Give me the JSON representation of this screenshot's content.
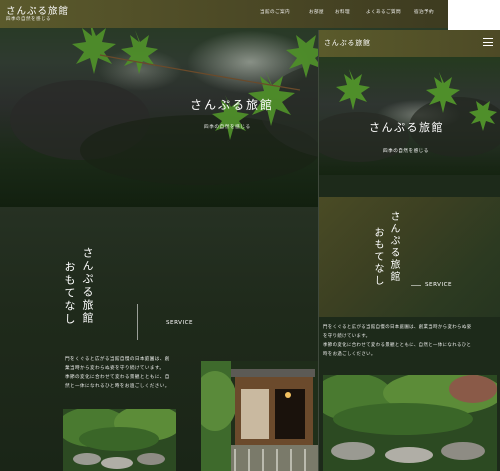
{
  "desktop": {
    "logo": "さんぷる旅館",
    "logo_sub": "四季の自然を感じる",
    "nav": [
      "当館のご案内",
      "お部屋",
      "お料理",
      "よくあるご質問",
      "宿泊予約"
    ],
    "hero_title": "さんぷる旅館",
    "hero_sub": "四季の自然を感じる",
    "heading_col1": "さんぷる旅館",
    "heading_col2": "おもてなし",
    "service_label": "SERVICE",
    "paragraph_1": "門をくぐると広がる当館自慢の日本庭園は、創",
    "paragraph_2": "業当時から変わらぬ姿を守り続けています。",
    "paragraph_3": "季節の変化に合わせて変わる景観とともに、自",
    "paragraph_4": "然と一体になれるひと時をお過ごしください。"
  },
  "mobile": {
    "logo": "さんぷる旅館",
    "hero_title": "さんぷる旅館",
    "hero_sub": "四季の自然を感じる",
    "heading_col1": "さんぷる旅館",
    "heading_col2": "おもてなし",
    "service_label": "SERVICE",
    "paragraph_1": "門をくぐると広がる当館自慢の日本庭園は、創業当時から変わらぬ姿",
    "paragraph_2": "を守り続けています。",
    "paragraph_3": "季節の変化に合わせて変わる景観とともに、自然と一体になれるひと",
    "paragraph_4": "時をお過ごしください。"
  }
}
